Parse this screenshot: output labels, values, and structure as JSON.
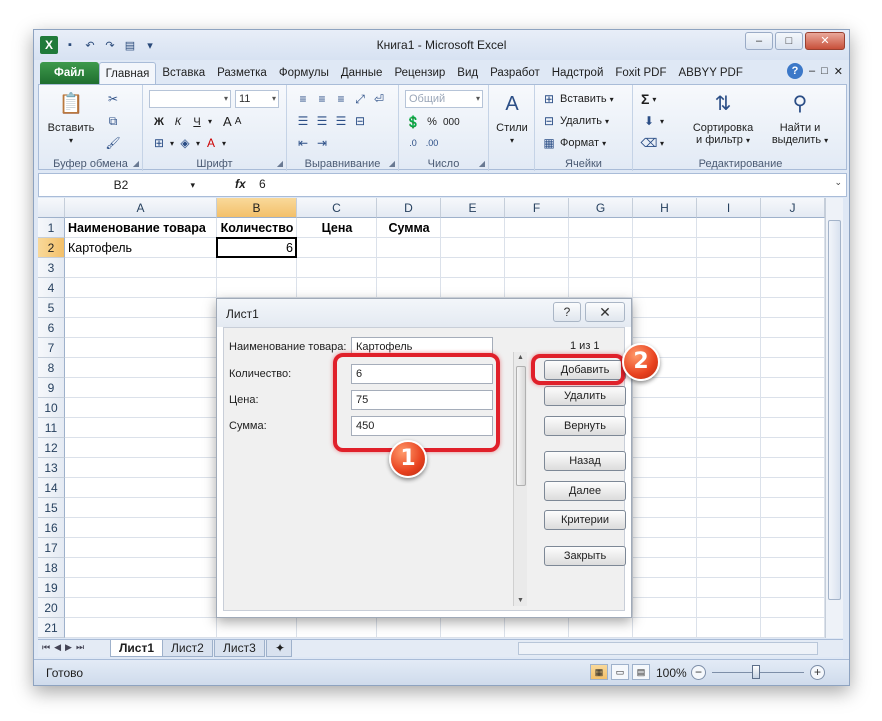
{
  "window": {
    "title": "Книга1 - Microsoft Excel",
    "min": "–",
    "max": "□",
    "close": "✕"
  },
  "qat": {
    "undo": "↶",
    "redo": "↷"
  },
  "tabs": [
    "Файл",
    "Главная",
    "Вставка",
    "Разметка",
    "Формулы",
    "Данные",
    "Рецензир",
    "Вид",
    "Разработ",
    "Надстрой",
    "Foxit PDF",
    "ABBYY PDF"
  ],
  "tabs_right": {
    "help": "?",
    "min": "–",
    "restore": "□",
    "close": "✕"
  },
  "ribbon": {
    "clipboard": {
      "label": "Буфер обмена",
      "paste": "Вставить"
    },
    "font": {
      "label": "Шрифт",
      "size": "11",
      "bold": "Ж",
      "italic": "К",
      "underline": "Ч",
      "grow": "A",
      "shrink": "A"
    },
    "alignment": {
      "label": "Выравнивание"
    },
    "number": {
      "label": "Число",
      "format": "Общий",
      "percent": "%",
      "thousands": "000"
    },
    "styles": {
      "label": "Стили"
    },
    "cells": {
      "label": "Ячейки",
      "insert": "Вставить",
      "delete": "Удалить",
      "format": "Формат"
    },
    "editing": {
      "label": "Редактирование",
      "sigma": "Σ",
      "sort": "Сортировка\nи фильтр",
      "sort_line1": "Сортировка",
      "sort_line2": "и фильтр",
      "find_line1": "Найти и",
      "find_line2": "выделить"
    }
  },
  "formula_bar": {
    "name_box": "B2",
    "fx": "fx",
    "value": "6"
  },
  "columns": [
    "A",
    "B",
    "C",
    "D",
    "E",
    "F",
    "G",
    "H",
    "I",
    "J"
  ],
  "rows": [
    "1",
    "2",
    "3",
    "4",
    "5",
    "6",
    "7",
    "8",
    "9",
    "10",
    "11",
    "12",
    "13",
    "14",
    "15",
    "16",
    "17",
    "18",
    "19",
    "20",
    "21"
  ],
  "cells": {
    "A1": "Наименование товара",
    "B1": "Количество",
    "C1": "Цена",
    "D1": "Сумма",
    "A2": "Картофель",
    "B2": "6"
  },
  "sheets": [
    "Лист1",
    "Лист2",
    "Лист3"
  ],
  "status": {
    "ready": "Готово",
    "zoom": "100%",
    "zoom_level": 100
  },
  "dialog": {
    "title": "Лист1",
    "help": "?",
    "close": "✕",
    "counter": "1 из 1",
    "fields": [
      {
        "label": "Наименование товара:",
        "value": "Картофель"
      },
      {
        "label": "Количество:",
        "value": "6"
      },
      {
        "label": "Цена:",
        "value": "75"
      },
      {
        "label": "Сумма:",
        "value": "450"
      }
    ],
    "buttons": [
      "Добавить",
      "Удалить",
      "Вернуть",
      "Назад",
      "Далее",
      "Критерии",
      "Закрыть"
    ]
  },
  "annotations": {
    "badge1": "1",
    "badge2": "2",
    "color": "#e0202a"
  }
}
